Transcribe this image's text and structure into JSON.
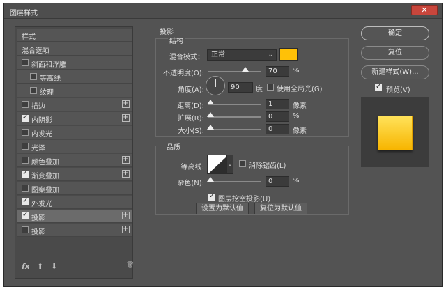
{
  "window": {
    "title": "图层样式",
    "close_glyph": "✕"
  },
  "style_list": {
    "header": "样式",
    "blend_options": "混合选项",
    "items": [
      {
        "label": "斜面和浮雕",
        "checked": false,
        "plus": false,
        "indent": false
      },
      {
        "label": "等高线",
        "checked": false,
        "plus": false,
        "indent": true
      },
      {
        "label": "纹理",
        "checked": false,
        "plus": false,
        "indent": true
      },
      {
        "label": "描边",
        "checked": false,
        "plus": true,
        "indent": false
      },
      {
        "label": "内阴影",
        "checked": true,
        "plus": true,
        "indent": false
      },
      {
        "label": "内发光",
        "checked": false,
        "plus": false,
        "indent": false
      },
      {
        "label": "光泽",
        "checked": false,
        "plus": false,
        "indent": false
      },
      {
        "label": "颜色叠加",
        "checked": false,
        "plus": true,
        "indent": false
      },
      {
        "label": "渐变叠加",
        "checked": true,
        "plus": true,
        "indent": false
      },
      {
        "label": "图案叠加",
        "checked": false,
        "plus": false,
        "indent": false
      },
      {
        "label": "外发光",
        "checked": true,
        "plus": false,
        "indent": false
      },
      {
        "label": "投影",
        "checked": true,
        "plus": true,
        "indent": false,
        "selected": true
      },
      {
        "label": "投影",
        "checked": false,
        "plus": true,
        "indent": false
      }
    ],
    "plus_glyph": "+",
    "footer": {
      "fx": "fx",
      "up": "⬆",
      "down": "⬇",
      "trash": "🗑"
    }
  },
  "drop_shadow": {
    "section_title": "投影",
    "structure": {
      "title": "结构",
      "blend_mode_label": "混合模式：",
      "blend_mode_value": "正常",
      "shadow_color": "#ffc107",
      "opacity_label": "不透明度(O):",
      "opacity_value": "70",
      "opacity_unit": "%",
      "opacity_level": 0.7,
      "angle_label": "角度(A):",
      "angle_value": "90",
      "angle_unit": "度",
      "global_light_label": "使用全局光(G)",
      "global_light_checked": false,
      "distance_label": "距离(D):",
      "distance_value": "1",
      "distance_unit": "像素",
      "spread_label": "扩展(R):",
      "spread_value": "0",
      "spread_unit": "%",
      "size_label": "大小(S):",
      "size_value": "0",
      "size_unit": "像素"
    },
    "quality": {
      "title": "品质",
      "contour_label": "等高线:",
      "anti_alias_label": "消除锯齿(L)",
      "anti_alias_checked": false,
      "noise_label": "杂色(N):",
      "noise_value": "0",
      "noise_unit": "%"
    },
    "layer_knockout_label": "图层挖空投影(U)",
    "layer_knockout_checked": true,
    "make_default": "设置为默认值",
    "reset_default": "复位为默认值"
  },
  "actions": {
    "ok": "确定",
    "reset": "复位",
    "new_style": "新建样式(W)...",
    "preview_label": "预览(V)",
    "preview_checked": true
  },
  "colors": {
    "dialog_bg": "#535353",
    "preview_top": "#ffe25a",
    "preview_bottom": "#f7b500"
  }
}
